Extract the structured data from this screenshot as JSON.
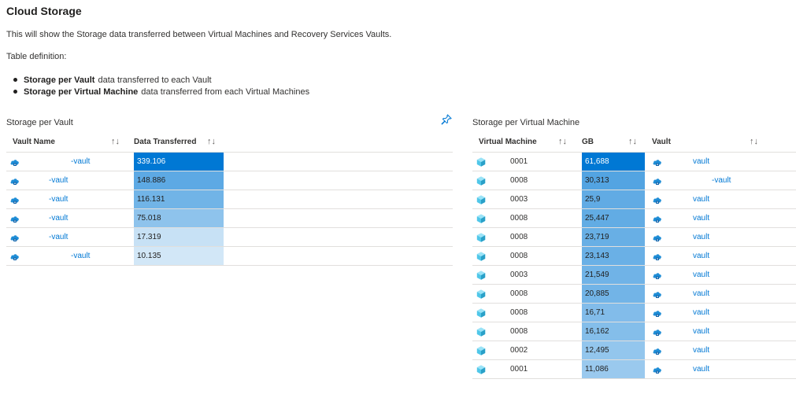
{
  "page": {
    "title": "Cloud Storage",
    "description": "This will show the Storage data transferred between Virtual Machines and Recovery Services Vaults.",
    "table_definition": "Table definition:",
    "bullets": [
      {
        "strong": "Storage per Vault",
        "text": "data transferred to each Vault"
      },
      {
        "strong": "Storage per Virtual Machine",
        "text": "data transferred from each Virtual Machines"
      }
    ]
  },
  "vault_table": {
    "title": "Storage per Vault",
    "columns": [
      "Vault Name",
      "Data Transferred"
    ],
    "sort_glyph": "↑↓",
    "rows": [
      {
        "name": "-vault",
        "value": "339.106",
        "level": 1.0
      },
      {
        "name": "-vault",
        "value": "148.886",
        "level": 0.439
      },
      {
        "name": "-vault",
        "value": "116.131",
        "level": 0.342
      },
      {
        "name": "-vault",
        "value": "75.018",
        "level": 0.221
      },
      {
        "name": "-vault",
        "value": "17.319",
        "level": 0.051
      },
      {
        "name": "-vault",
        "value": "10.135",
        "level": 0.03
      }
    ]
  },
  "vm_table": {
    "title": "Storage per Virtual Machine",
    "columns": [
      "Virtual Machine",
      "GB",
      "Vault"
    ],
    "sort_glyph": "↑↓",
    "rows": [
      {
        "vm": "0001",
        "gb": "61,688",
        "vault": "vault",
        "level": 1.0
      },
      {
        "vm": "0008",
        "gb": "30,313",
        "vault": "-vault",
        "level": 0.491
      },
      {
        "vm": "0003",
        "gb": "25,9",
        "vault": "vault",
        "level": 0.42
      },
      {
        "vm": "0008",
        "gb": "25,447",
        "vault": "vault",
        "level": 0.413
      },
      {
        "vm": "0008",
        "gb": "23,719",
        "vault": "vault",
        "level": 0.385
      },
      {
        "vm": "0008",
        "gb": "23,143",
        "vault": "vault",
        "level": 0.375
      },
      {
        "vm": "0003",
        "gb": "21,549",
        "vault": "vault",
        "level": 0.349
      },
      {
        "vm": "0008",
        "gb": "20,885",
        "vault": "vault",
        "level": 0.339
      },
      {
        "vm": "0008",
        "gb": "16,71",
        "vault": "vault",
        "level": 0.271
      },
      {
        "vm": "0008",
        "gb": "16,162",
        "vault": "vault",
        "level": 0.262
      },
      {
        "vm": "0002",
        "gb": "12,495",
        "vault": "vault",
        "level": 0.203
      },
      {
        "vm": "0001",
        "gb": "11,086",
        "vault": "vault",
        "level": 0.18
      }
    ]
  },
  "colors": {
    "accent": "#0078d4",
    "heat_max": "#0078d4",
    "heat_min": "#eff6fc",
    "vault_icon": "#1f8dd6",
    "vm_icon": "#50c7e9"
  },
  "icons": {
    "vault": "recovery-vault-icon",
    "vm": "virtual-machine-icon",
    "pin": "pin-icon"
  }
}
